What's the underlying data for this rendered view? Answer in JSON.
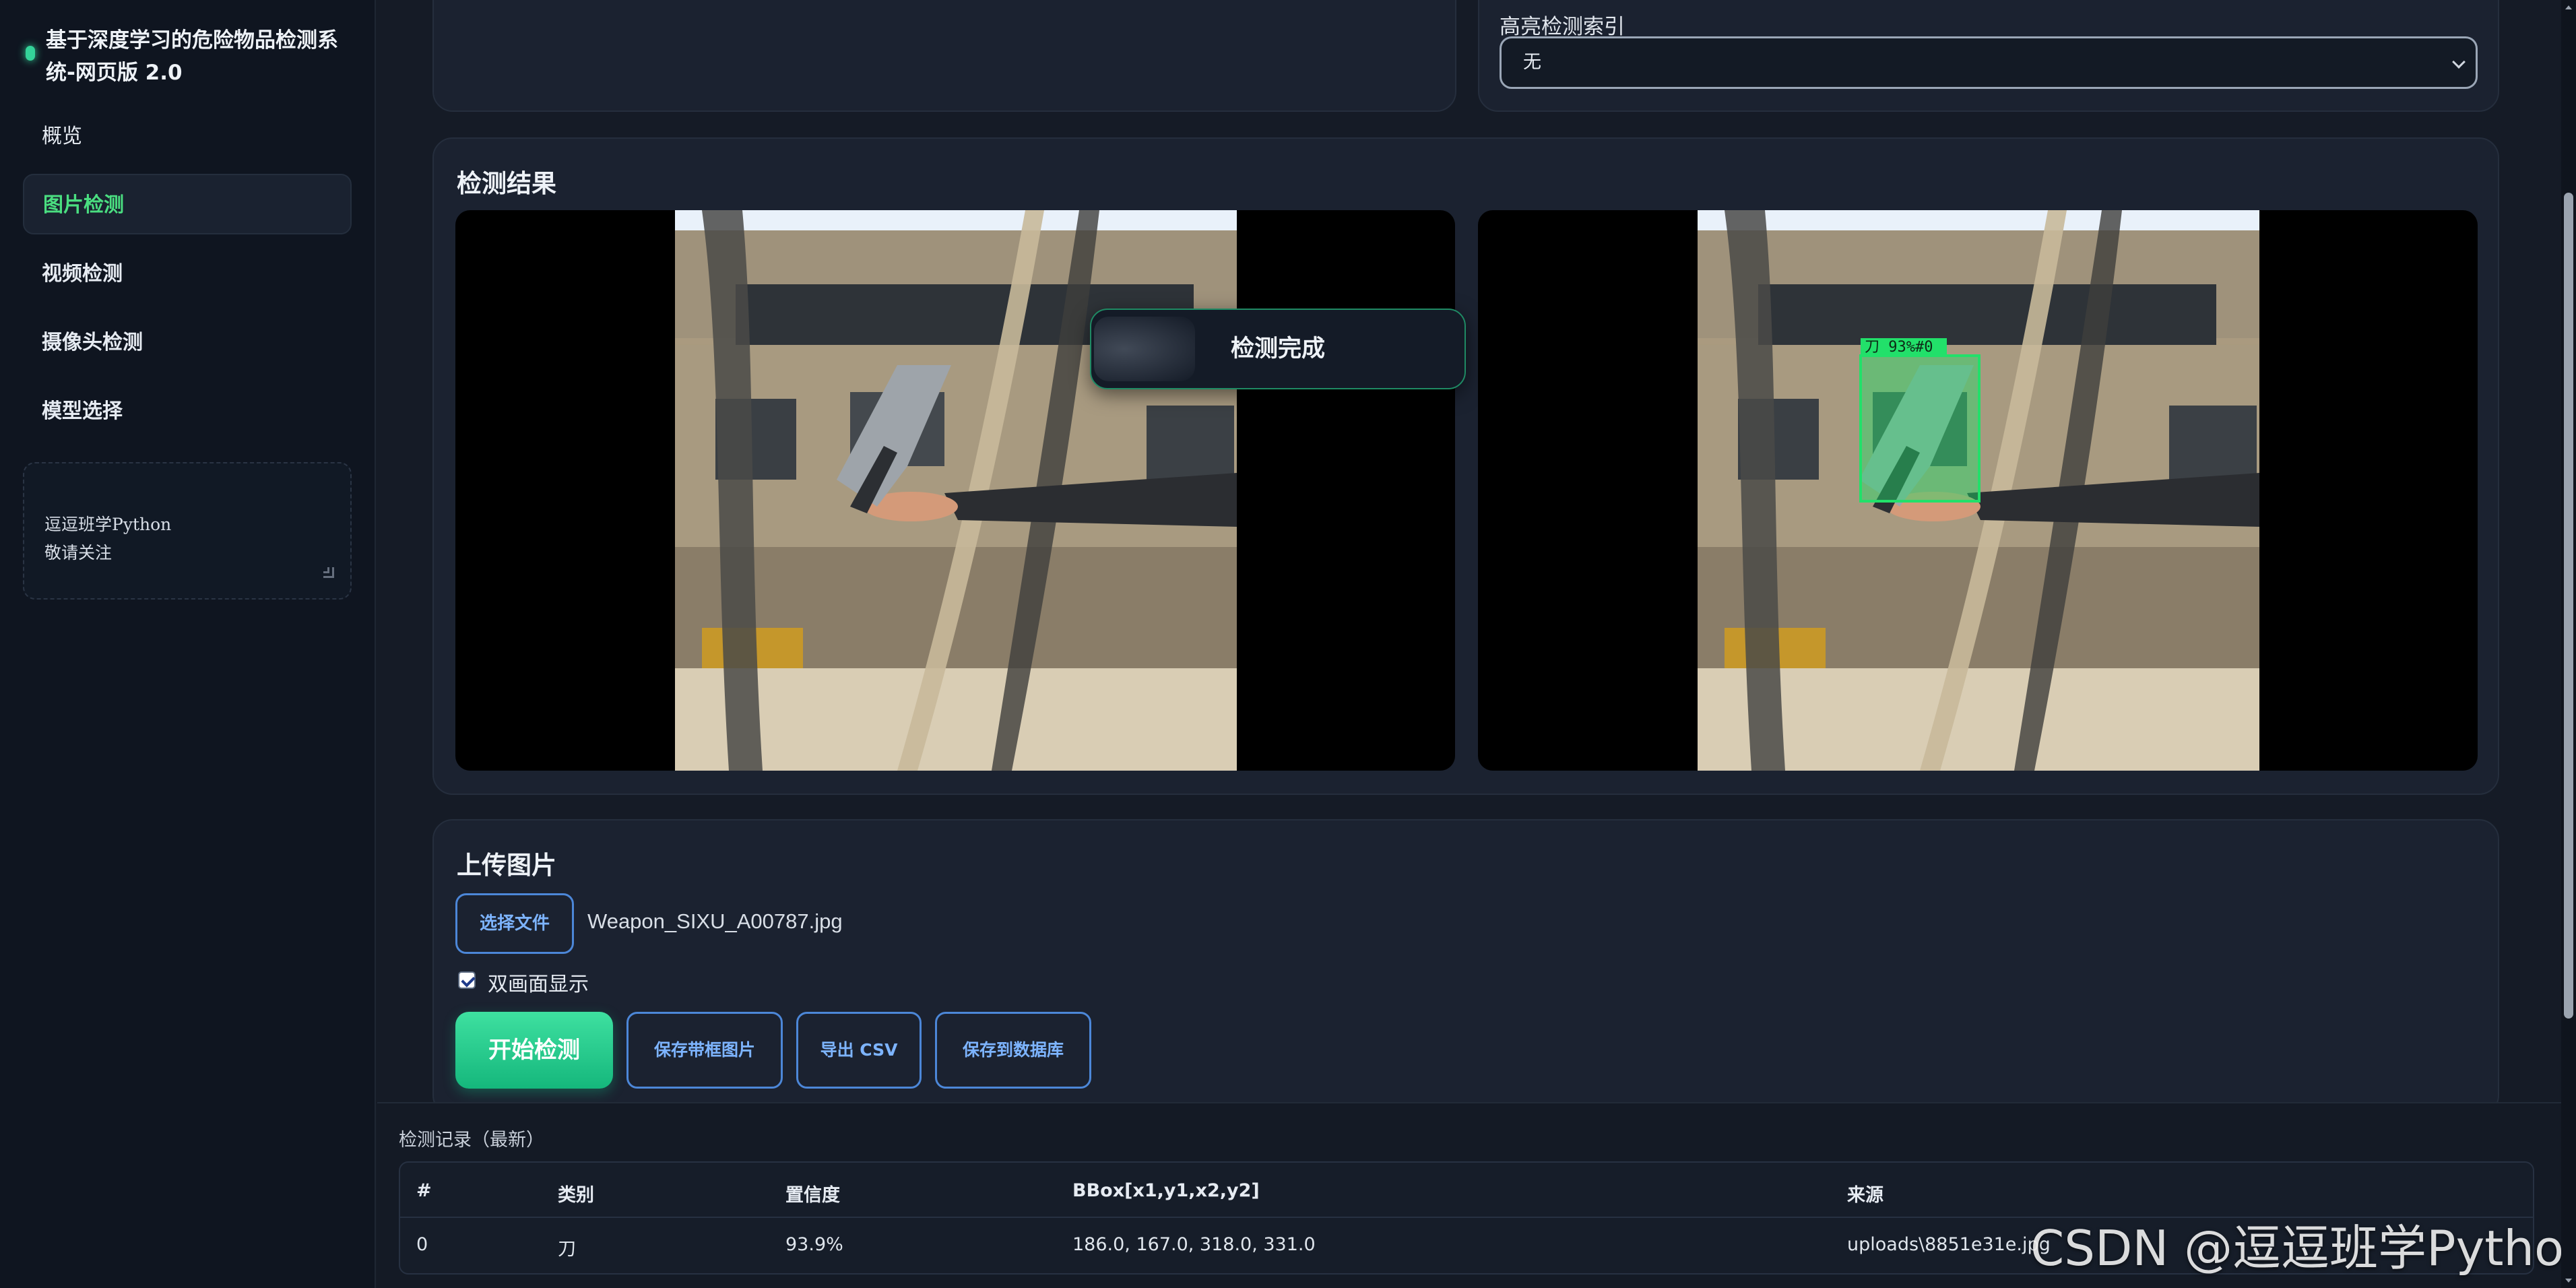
{
  "app": {
    "title": "基于深度学习的危险物品检测系统-网页版 2.0"
  },
  "sidebar": {
    "items": [
      {
        "label": "概览",
        "active": false
      },
      {
        "label": "图片检测",
        "active": true
      },
      {
        "label": "视频检测",
        "active": false
      },
      {
        "label": "摄像头检测",
        "active": false
      },
      {
        "label": "模型选择",
        "active": false
      }
    ],
    "note": "逗逗班学Python\n敬请关注"
  },
  "highlight": {
    "label": "高亮检测索引",
    "value": "无"
  },
  "results": {
    "title": "检测结果",
    "toast": "检测完成",
    "bbox_label": "刀 93%#0"
  },
  "upload": {
    "title": "上传图片",
    "choose_file": "选择文件",
    "file_name": "Weapon_SIXU_A00787.jpg",
    "dual_view_label": "双画面显示",
    "dual_view_checked": true,
    "start_button": "开始检测",
    "save_boxed_button": "保存带框图片",
    "export_csv_button": "导出 CSV",
    "save_db_button": "保存到数据库"
  },
  "records": {
    "title": "检测记录（最新）",
    "columns": [
      "#",
      "类别",
      "置信度",
      "BBox[x1,y1,x2,y2]",
      "来源"
    ],
    "rows": [
      [
        "0",
        "刀",
        "93.9%",
        "186.0, 167.0, 318.0, 331.0",
        "uploads\\8851e31e.jpg"
      ]
    ]
  },
  "watermark": "CSDN @逗逗班学Python",
  "colors": {
    "accent_green": "#34d399",
    "button_blue": "#4c87d8",
    "bbox_green": "#22e06a",
    "background": "#151b26"
  }
}
